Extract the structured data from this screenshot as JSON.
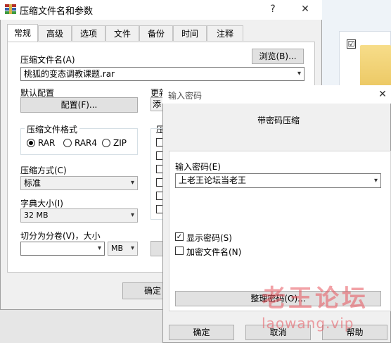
{
  "background": {
    "checkbox_checked": "☑"
  },
  "main_dialog": {
    "title": "压缩文件名和参数",
    "help_glyph": "?",
    "close_glyph": "✕",
    "tabs": [
      "常规",
      "高级",
      "选项",
      "文件",
      "备份",
      "时间",
      "注释"
    ],
    "active_tab": 0,
    "archive_name_label": "压缩文件名(A)",
    "archive_name_value": "桃狐的变态调教课题.rar",
    "browse_button": "浏览(B)...",
    "default_config_label": "默认配置",
    "config_button": "配置(F)...",
    "update_label_partial": "更新",
    "update_combo_partial": "添",
    "format_group_label": "压缩文件格式",
    "formats": [
      "RAR",
      "RAR4",
      "ZIP"
    ],
    "selected_format": "RAR",
    "options_group_partial": "压",
    "method_label": "压缩方式(C)",
    "method_value": "标准",
    "dict_label": "字典大小(I)",
    "dict_value": "32 MB",
    "split_label": "切分为分卷(V)，大小",
    "split_value": "",
    "split_unit": "MB",
    "ok_button_partial": "确定"
  },
  "password_dialog": {
    "title": "输入密码",
    "close_glyph": "✕",
    "heading": "带密码压缩",
    "password_label": "输入密码(E)",
    "password_value": "上老王论坛当老王",
    "show_password_label": "显示密码(S)",
    "show_password_checked": true,
    "encrypt_names_label": "加密文件名(N)",
    "encrypt_names_checked": false,
    "organize_button": "整理密码(O)...",
    "ok_button": "确定",
    "cancel_button": "取消",
    "help_button": "帮助"
  },
  "watermark": {
    "text": "老王论坛",
    "url": "laowang.vip",
    "color": "#e8545c"
  },
  "colors": {
    "dialog_bg": "#f0f0f0",
    "button_bg": "#e1e1e1",
    "button_border": "#adadad"
  }
}
